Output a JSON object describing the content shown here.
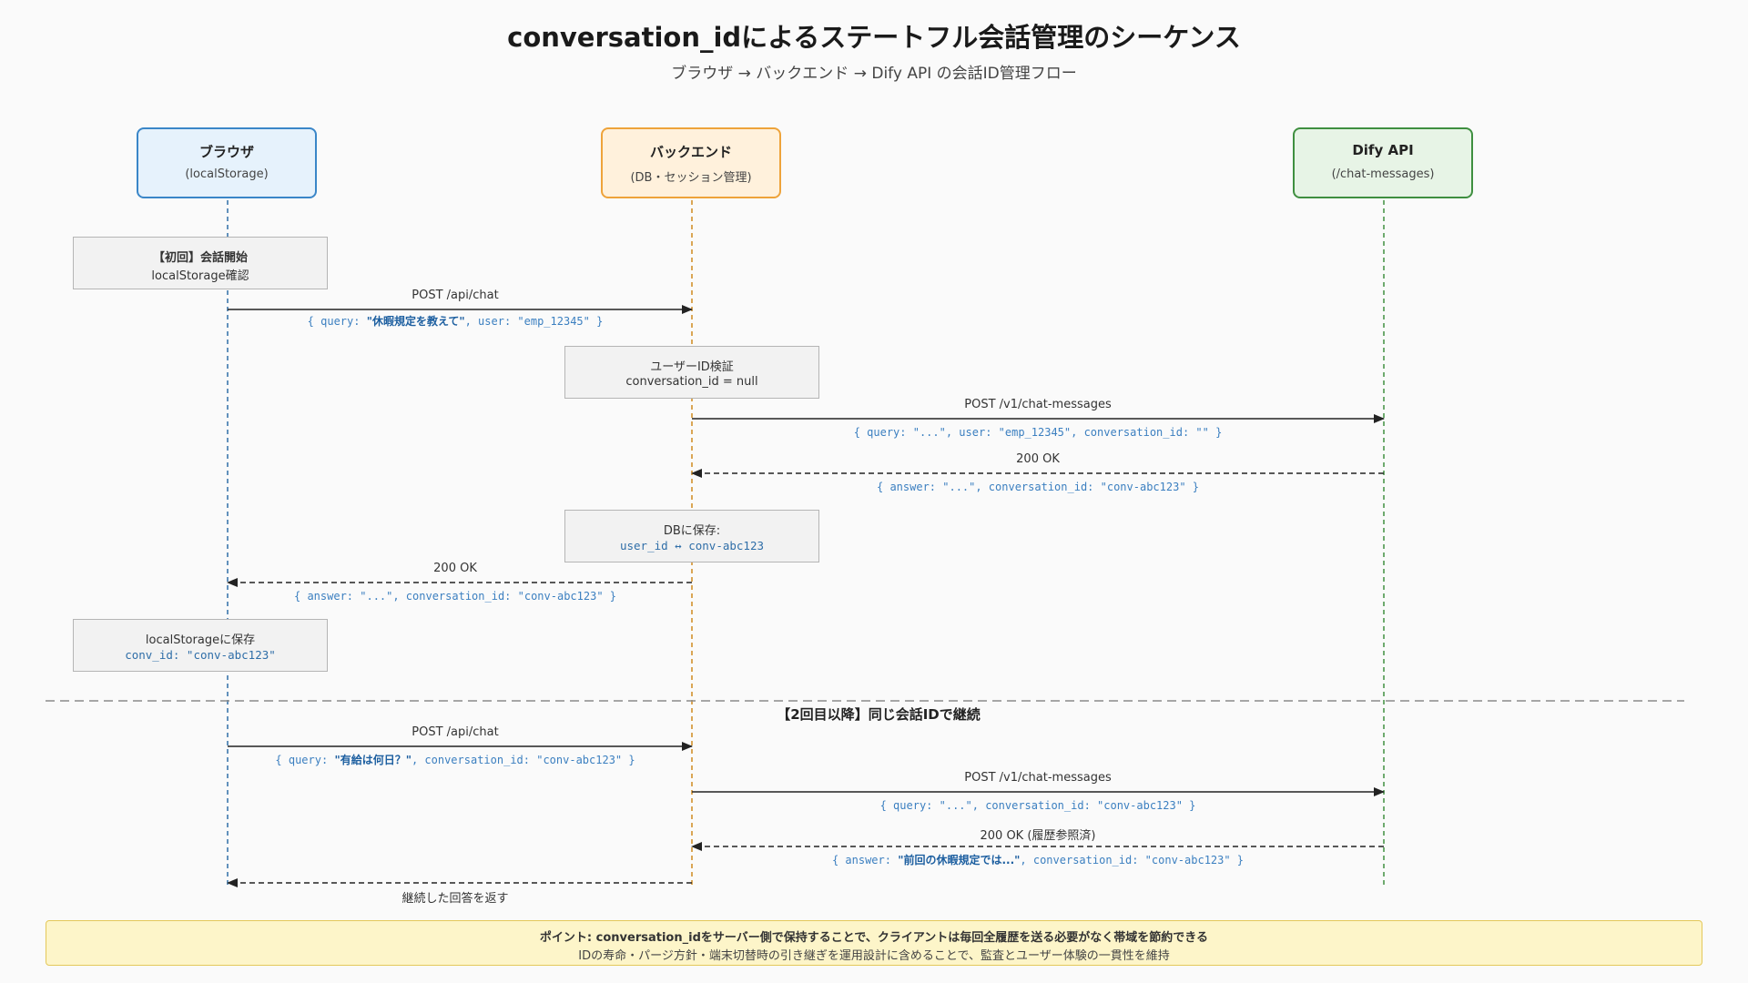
{
  "header": {
    "title": "conversation_idによるステートフル会話管理のシーケンス",
    "subtitle": "ブラウザ → バックエンド → Dify API の会話ID管理フロー"
  },
  "actors": [
    {
      "name": "ブラウザ",
      "sub": "(localStorage)",
      "fill": "#e6f2fc",
      "stroke": "#3a86c8",
      "lifeline": "#2f6ea8"
    },
    {
      "name": "バックエンド",
      "sub": "(DB・セッション管理)",
      "fill": "#fff1dc",
      "stroke": "#eea33a",
      "lifeline": "#d08a1e"
    },
    {
      "name": "Dify API",
      "sub": "(/chat-messages)",
      "fill": "#e7f4e6",
      "stroke": "#3f8f40",
      "lifeline": "#3f8f40"
    }
  ],
  "notes": {
    "first": {
      "l1": "【初回】会話開始",
      "l2": "localStorage確認"
    },
    "verify": {
      "l1": "ユーザーID検証",
      "l2": "conversation_id = null"
    },
    "db": {
      "l1": "DBに保存:",
      "l2": "user_id ↔ conv-abc123"
    },
    "ls": {
      "l1": "localStorageに保存",
      "l2": "conv_id: \"conv-abc123\""
    }
  },
  "messages": {
    "m1": {
      "label": "POST /api/chat",
      "pre": "{ query: ",
      "hl": "\"休暇規定を教えて\"",
      "post": ", user: \"emp_12345\" }"
    },
    "m2": {
      "label": "POST /v1/chat-messages",
      "pre": "{ query: \"...\", user: \"emp_12345\", conversation_id: \"\" }"
    },
    "m3": {
      "label": "200 OK",
      "pre": "{ answer: \"...\", conversation_id: \"conv-abc123\" }"
    },
    "m4": {
      "label": "200 OK",
      "pre": "{ answer: \"...\", conversation_id: \"conv-abc123\" }"
    },
    "m5": {
      "label": "POST /api/chat",
      "pre": "{ query: ",
      "hl": "\"有給は何日？\"",
      "post": ", conversation_id: \"conv-abc123\" }"
    },
    "m6": {
      "label": "POST /v1/chat-messages",
      "pre": "{ query: \"...\", conversation_id: \"conv-abc123\" }"
    },
    "m7": {
      "label": "200 OK (履歴参照済)",
      "pre": "{ answer: ",
      "hl": "\"前回の休暇規定では...\"",
      "post": ", conversation_id: \"conv-abc123\" }"
    },
    "m8": {
      "label": "継続した回答を返す"
    }
  },
  "separator": {
    "label": "【2回目以降】同じ会話IDで継続"
  },
  "point": {
    "line1": "ポイント: conversation_idをサーバー側で保持することで、クライアントは毎回全履歴を送る必要がなく帯域を節約できる",
    "line2": "IDの寿命・パージ方針・端末切替時の引き継ぎを運用設計に含めることで、監査とユーザー体験の一貫性を維持"
  }
}
